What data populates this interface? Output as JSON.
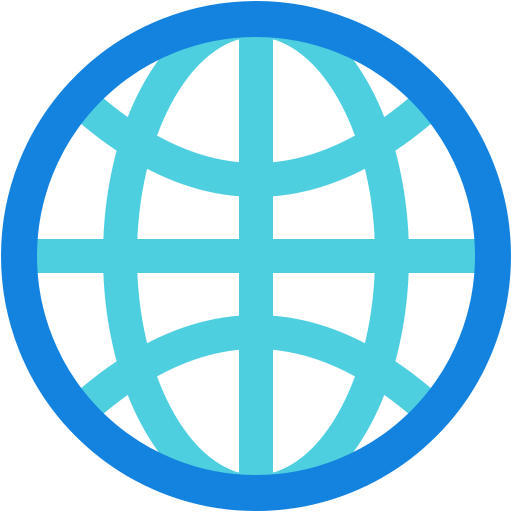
{
  "icon": {
    "name": "globe-icon",
    "colors": {
      "outer_ring": "#1483E0",
      "grid_lines": "#4ECFE0",
      "background": "#FFFFFF"
    }
  }
}
